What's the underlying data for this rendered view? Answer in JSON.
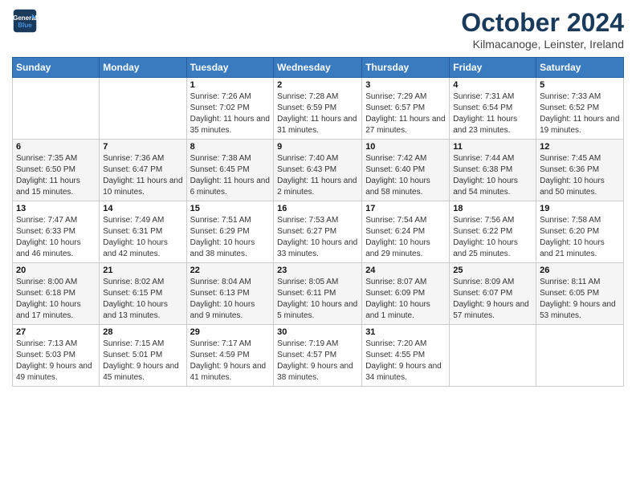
{
  "header": {
    "logo_line1": "General",
    "logo_line2": "Blue",
    "main_title": "October 2024",
    "subtitle": "Kilmacanoge, Leinster, Ireland"
  },
  "calendar": {
    "days_of_week": [
      "Sunday",
      "Monday",
      "Tuesday",
      "Wednesday",
      "Thursday",
      "Friday",
      "Saturday"
    ],
    "weeks": [
      [
        {
          "day": "",
          "info": ""
        },
        {
          "day": "",
          "info": ""
        },
        {
          "day": "1",
          "info": "Sunrise: 7:26 AM\nSunset: 7:02 PM\nDaylight: 11 hours and 35 minutes."
        },
        {
          "day": "2",
          "info": "Sunrise: 7:28 AM\nSunset: 6:59 PM\nDaylight: 11 hours and 31 minutes."
        },
        {
          "day": "3",
          "info": "Sunrise: 7:29 AM\nSunset: 6:57 PM\nDaylight: 11 hours and 27 minutes."
        },
        {
          "day": "4",
          "info": "Sunrise: 7:31 AM\nSunset: 6:54 PM\nDaylight: 11 hours and 23 minutes."
        },
        {
          "day": "5",
          "info": "Sunrise: 7:33 AM\nSunset: 6:52 PM\nDaylight: 11 hours and 19 minutes."
        }
      ],
      [
        {
          "day": "6",
          "info": "Sunrise: 7:35 AM\nSunset: 6:50 PM\nDaylight: 11 hours and 15 minutes."
        },
        {
          "day": "7",
          "info": "Sunrise: 7:36 AM\nSunset: 6:47 PM\nDaylight: 11 hours and 10 minutes."
        },
        {
          "day": "8",
          "info": "Sunrise: 7:38 AM\nSunset: 6:45 PM\nDaylight: 11 hours and 6 minutes."
        },
        {
          "day": "9",
          "info": "Sunrise: 7:40 AM\nSunset: 6:43 PM\nDaylight: 11 hours and 2 minutes."
        },
        {
          "day": "10",
          "info": "Sunrise: 7:42 AM\nSunset: 6:40 PM\nDaylight: 10 hours and 58 minutes."
        },
        {
          "day": "11",
          "info": "Sunrise: 7:44 AM\nSunset: 6:38 PM\nDaylight: 10 hours and 54 minutes."
        },
        {
          "day": "12",
          "info": "Sunrise: 7:45 AM\nSunset: 6:36 PM\nDaylight: 10 hours and 50 minutes."
        }
      ],
      [
        {
          "day": "13",
          "info": "Sunrise: 7:47 AM\nSunset: 6:33 PM\nDaylight: 10 hours and 46 minutes."
        },
        {
          "day": "14",
          "info": "Sunrise: 7:49 AM\nSunset: 6:31 PM\nDaylight: 10 hours and 42 minutes."
        },
        {
          "day": "15",
          "info": "Sunrise: 7:51 AM\nSunset: 6:29 PM\nDaylight: 10 hours and 38 minutes."
        },
        {
          "day": "16",
          "info": "Sunrise: 7:53 AM\nSunset: 6:27 PM\nDaylight: 10 hours and 33 minutes."
        },
        {
          "day": "17",
          "info": "Sunrise: 7:54 AM\nSunset: 6:24 PM\nDaylight: 10 hours and 29 minutes."
        },
        {
          "day": "18",
          "info": "Sunrise: 7:56 AM\nSunset: 6:22 PM\nDaylight: 10 hours and 25 minutes."
        },
        {
          "day": "19",
          "info": "Sunrise: 7:58 AM\nSunset: 6:20 PM\nDaylight: 10 hours and 21 minutes."
        }
      ],
      [
        {
          "day": "20",
          "info": "Sunrise: 8:00 AM\nSunset: 6:18 PM\nDaylight: 10 hours and 17 minutes."
        },
        {
          "day": "21",
          "info": "Sunrise: 8:02 AM\nSunset: 6:15 PM\nDaylight: 10 hours and 13 minutes."
        },
        {
          "day": "22",
          "info": "Sunrise: 8:04 AM\nSunset: 6:13 PM\nDaylight: 10 hours and 9 minutes."
        },
        {
          "day": "23",
          "info": "Sunrise: 8:05 AM\nSunset: 6:11 PM\nDaylight: 10 hours and 5 minutes."
        },
        {
          "day": "24",
          "info": "Sunrise: 8:07 AM\nSunset: 6:09 PM\nDaylight: 10 hours and 1 minute."
        },
        {
          "day": "25",
          "info": "Sunrise: 8:09 AM\nSunset: 6:07 PM\nDaylight: 9 hours and 57 minutes."
        },
        {
          "day": "26",
          "info": "Sunrise: 8:11 AM\nSunset: 6:05 PM\nDaylight: 9 hours and 53 minutes."
        }
      ],
      [
        {
          "day": "27",
          "info": "Sunrise: 7:13 AM\nSunset: 5:03 PM\nDaylight: 9 hours and 49 minutes."
        },
        {
          "day": "28",
          "info": "Sunrise: 7:15 AM\nSunset: 5:01 PM\nDaylight: 9 hours and 45 minutes."
        },
        {
          "day": "29",
          "info": "Sunrise: 7:17 AM\nSunset: 4:59 PM\nDaylight: 9 hours and 41 minutes."
        },
        {
          "day": "30",
          "info": "Sunrise: 7:19 AM\nSunset: 4:57 PM\nDaylight: 9 hours and 38 minutes."
        },
        {
          "day": "31",
          "info": "Sunrise: 7:20 AM\nSunset: 4:55 PM\nDaylight: 9 hours and 34 minutes."
        },
        {
          "day": "",
          "info": ""
        },
        {
          "day": "",
          "info": ""
        }
      ]
    ]
  }
}
